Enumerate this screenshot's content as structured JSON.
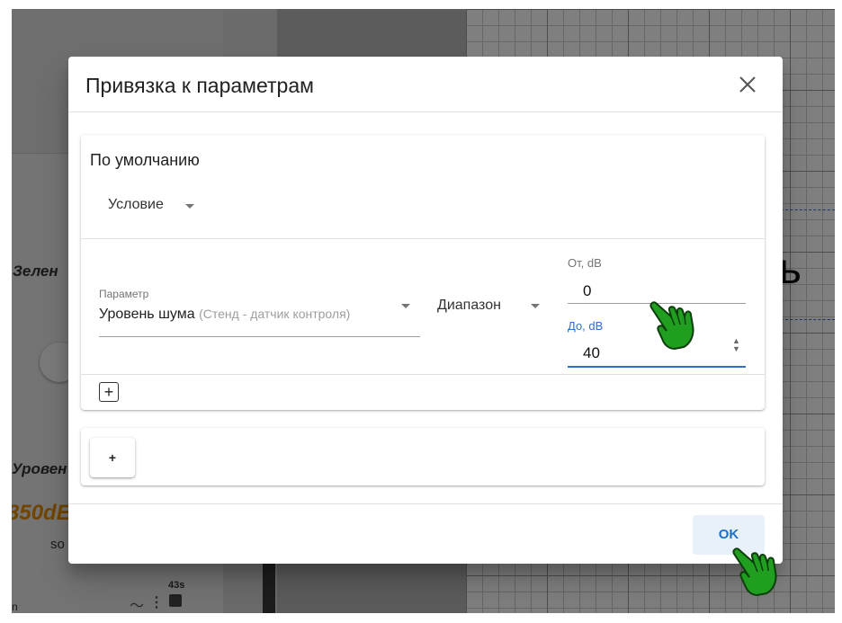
{
  "background": {
    "green_label": "Зелен",
    "level_label": "Уровен",
    "value_text": "350dE",
    "sound_text": "so",
    "time_text": "43s",
    "bottom_text": "n",
    "big_letter": "ь"
  },
  "dialog": {
    "title": "Привязка к параметрам",
    "close_icon": "close-icon",
    "default_card": {
      "title": "По умолчанию",
      "condition_select": "Условие",
      "parameter_label": "Параметр",
      "parameter_value": "Уровень шума",
      "parameter_source": "(Стенд - датчик контроля)",
      "range_select": "Диапазон",
      "from_label": "От, dB",
      "from_value": "0",
      "to_label": "До, dB",
      "to_value": "40",
      "add_condition_label": "+"
    },
    "add_card": {
      "add_button_label": "+"
    },
    "ok_button_label": "OK"
  },
  "colors": {
    "accent": "#1e6fc4",
    "focus_blue": "#2f6fd0",
    "hand_cursor": "#1f9e1f",
    "background_value": "#e08a00"
  }
}
